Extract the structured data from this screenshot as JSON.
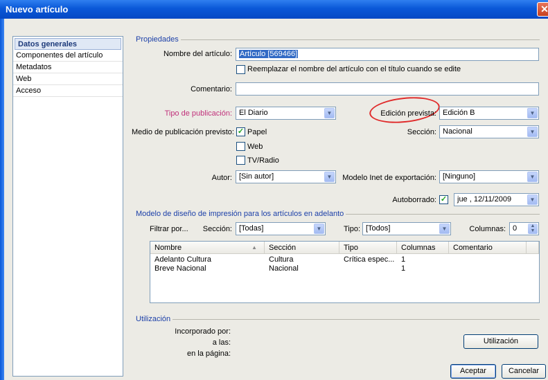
{
  "window": {
    "title": "Nuevo artículo",
    "close": "✕"
  },
  "nav": [
    "Datos generales",
    "Componentes del artículo",
    "Metadatos",
    "Web",
    "Acceso"
  ],
  "propiedades": {
    "group_title": "Propiedades",
    "nombre_label": "Nombre del artículo:",
    "nombre_value": "Artículo [569466]",
    "reemplazar_label": "Reemplazar el nombre del artículo con el título cuando se edite",
    "comentario_label": "Comentario:",
    "comentario_value": "",
    "tipo_label": "Tipo de publicación:",
    "tipo_value": "El Diario",
    "edicion_label": "Edición prevista:",
    "edicion_value": "Edición B",
    "medio_label": "Medio de publicación previsto:",
    "medio_options": [
      {
        "label": "Papel",
        "checked": true
      },
      {
        "label": "Web",
        "checked": false
      },
      {
        "label": "TV/Radio",
        "checked": false
      }
    ],
    "seccion_label": "Sección:",
    "seccion_value": "Nacional",
    "autor_label": "Autor:",
    "autor_value": "[Sin autor]",
    "modelo_inet_label": "Modelo Inet de exportación:",
    "modelo_inet_value": "[Ninguno]",
    "autoborrado_label": "Autoborrado:",
    "autoborrado_checked": true,
    "autoborrado_value": "jue , 12/11/2009"
  },
  "modelo": {
    "group_title": "Modelo de diseño de impresión para los artículos en adelanto",
    "filtrar_label": "Filtrar por...",
    "seccion_label": "Sección:",
    "seccion_value": "[Todas]",
    "tipo_label": "Tipo:",
    "tipo_value": "[Todos]",
    "columnas_label": "Columnas:",
    "columnas_value": "0",
    "headers": [
      "Nombre",
      "Sección",
      "Tipo",
      "Columnas",
      "Comentario"
    ],
    "rows": [
      [
        "Adelanto Cultura",
        "Cultura",
        "Crítica espec...",
        "1",
        ""
      ],
      [
        "Breve Nacional",
        "Nacional",
        "",
        "1",
        ""
      ]
    ]
  },
  "utilizacion": {
    "group_title": "Utilización",
    "incorporado_label": "Incorporado por:",
    "alas_label": "a las:",
    "pagina_label": "en la página:",
    "button": "Utilización"
  },
  "footer": {
    "aceptar": "Aceptar",
    "cancelar": "Cancelar"
  }
}
